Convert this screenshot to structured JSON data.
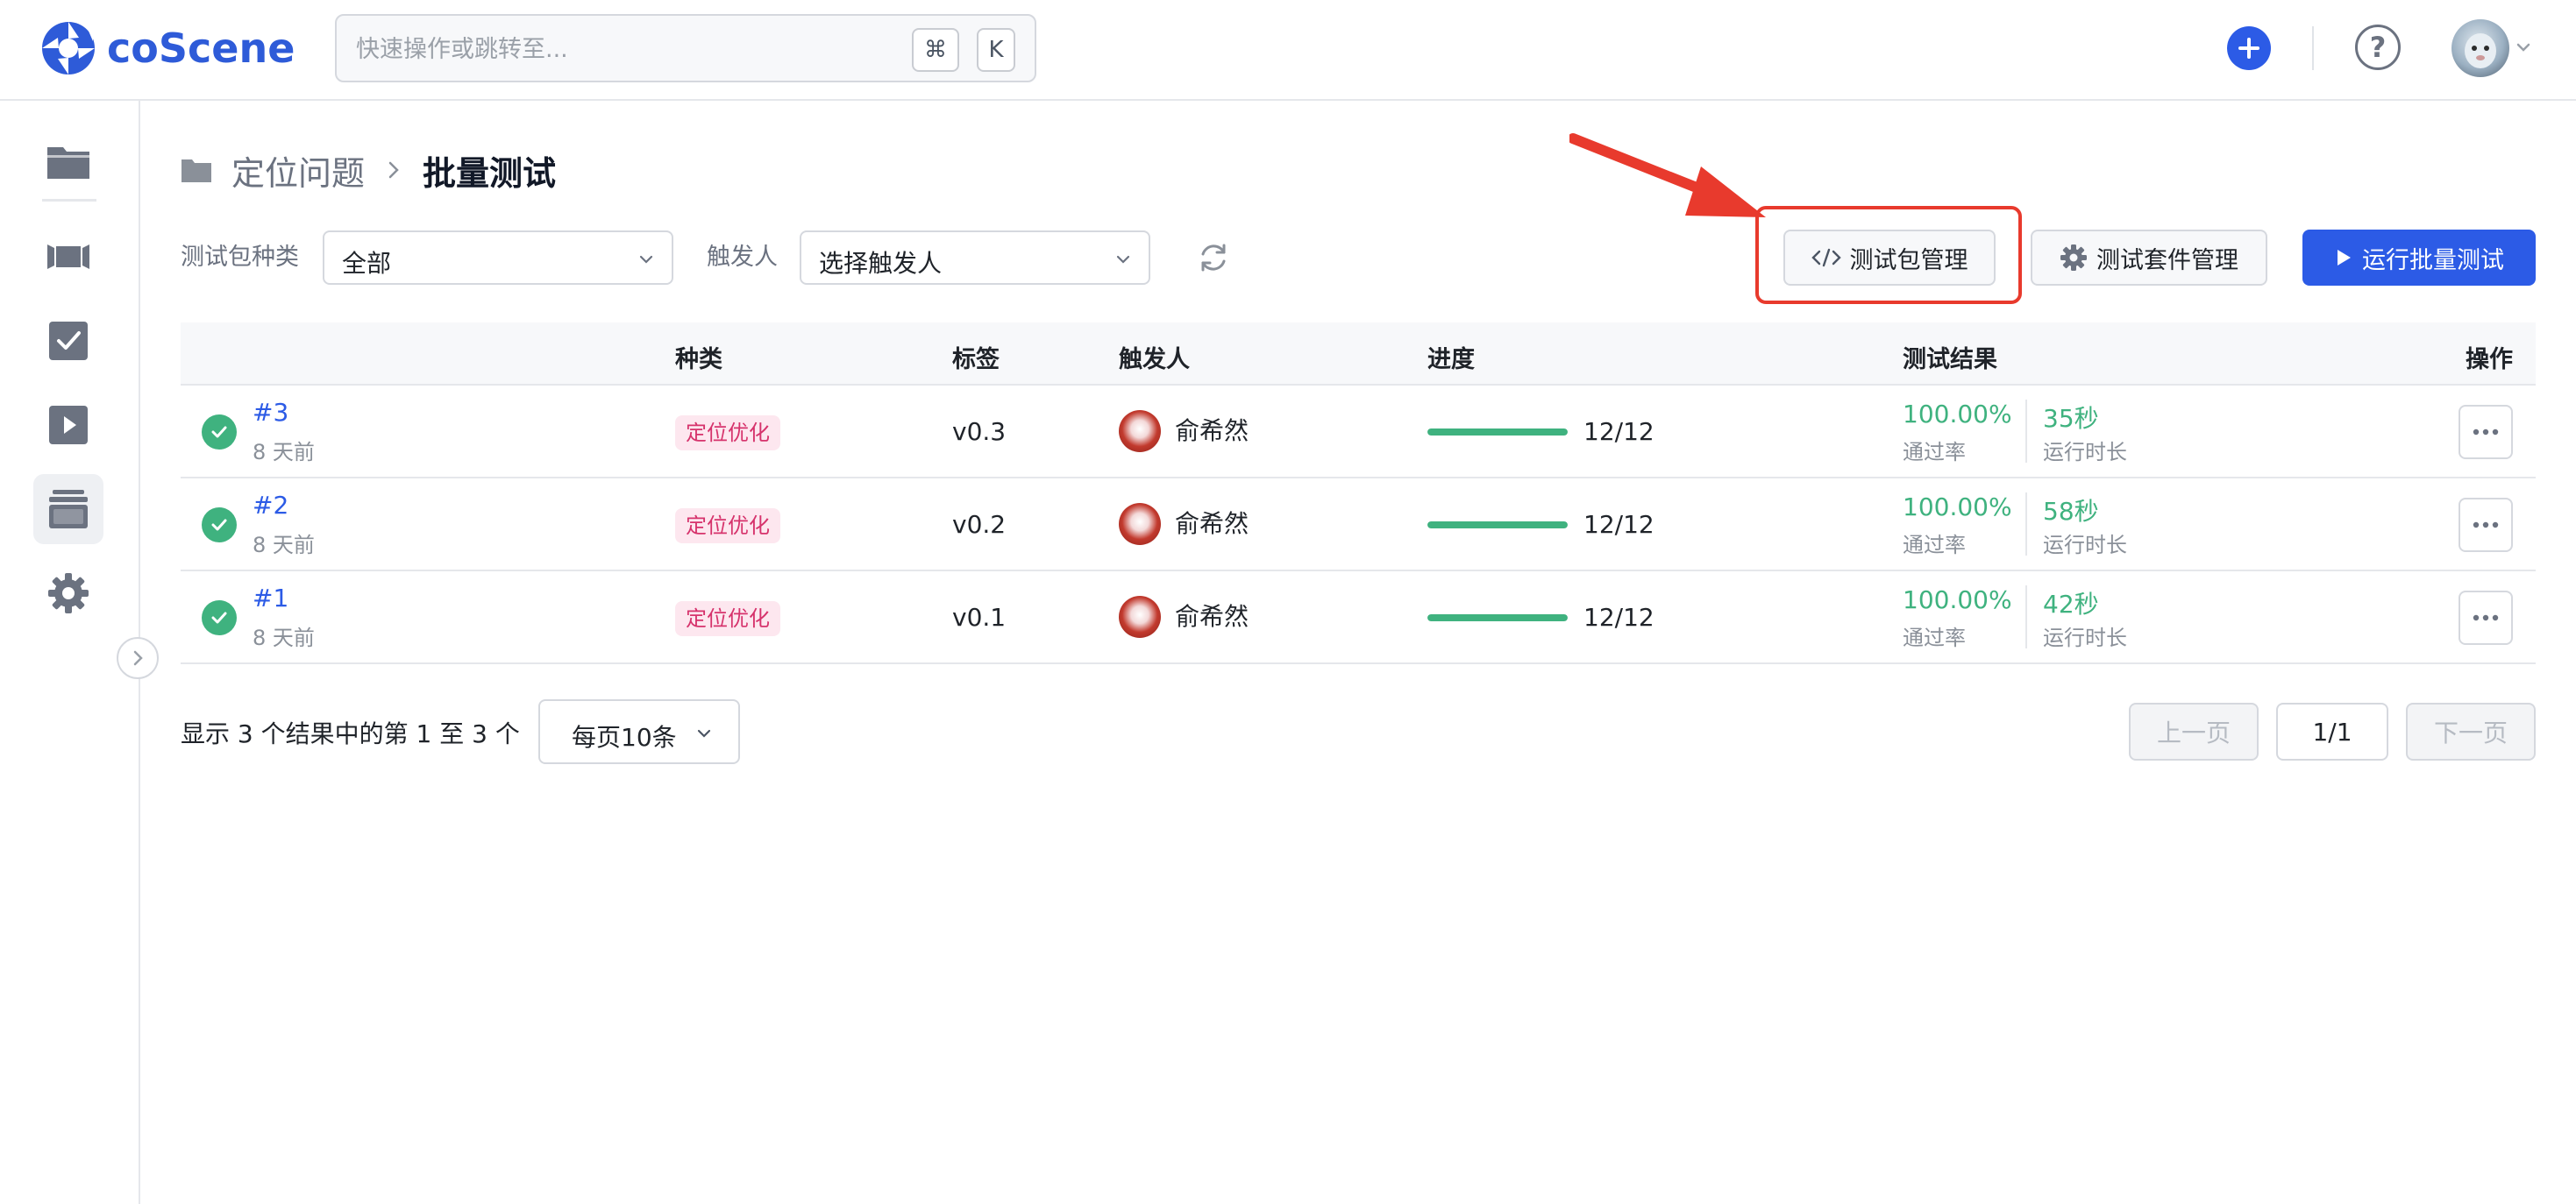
{
  "app": {
    "brand": "coScene",
    "brand_color": "#2e5bd8",
    "accent_color": "#2c5be6"
  },
  "search": {
    "placeholder": "快速操作或跳转至...",
    "shortcut_cmd": "⌘",
    "shortcut_key": "K"
  },
  "header": {
    "add_icon": "plus-circle-icon",
    "help_icon": "question-circle-icon",
    "help_glyph": "?"
  },
  "sidebar": {
    "items": [
      {
        "name": "records",
        "icon": "folder-icon"
      },
      {
        "name": "scenes",
        "icon": "film-icon"
      },
      {
        "name": "tasks",
        "icon": "checkbox-icon"
      },
      {
        "name": "playback",
        "icon": "play-icon"
      },
      {
        "name": "batch-test",
        "icon": "archive-icon",
        "active": true
      },
      {
        "name": "settings",
        "icon": "gear-icon"
      }
    ]
  },
  "breadcrumb": {
    "parent": "定位问题",
    "current": "批量测试"
  },
  "filters": {
    "package_type_label": "测试包种类",
    "package_type_value": "全部",
    "trigger_label": "触发人",
    "trigger_placeholder": "选择触发人"
  },
  "actions": {
    "package_manage": "测试包管理",
    "suite_manage": "测试套件管理",
    "run_batch": "运行批量测试"
  },
  "table": {
    "headers": {
      "kind": "种类",
      "tag": "标签",
      "trigger": "触发人",
      "progress": "进度",
      "result": "测试结果",
      "actions": "操作"
    },
    "rows": [
      {
        "id": "#3",
        "time": "8 天前",
        "kind": "定位优化",
        "tag": "v0.3",
        "user": "俞希然",
        "progress_text": "12/12",
        "progress_pct": 100,
        "pass_rate": "100.00%",
        "pass_rate_label": "通过率",
        "duration": "35秒",
        "duration_label": "运行时长"
      },
      {
        "id": "#2",
        "time": "8 天前",
        "kind": "定位优化",
        "tag": "v0.2",
        "user": "俞希然",
        "progress_text": "12/12",
        "progress_pct": 100,
        "pass_rate": "100.00%",
        "pass_rate_label": "通过率",
        "duration": "58秒",
        "duration_label": "运行时长"
      },
      {
        "id": "#1",
        "time": "8 天前",
        "kind": "定位优化",
        "tag": "v0.1",
        "user": "俞希然",
        "progress_text": "12/12",
        "progress_pct": 100,
        "pass_rate": "100.00%",
        "pass_rate_label": "通过率",
        "duration": "42秒",
        "duration_label": "运行时长"
      }
    ]
  },
  "pagination": {
    "summary": "显示 3 个结果中的第 1 至 3 个",
    "per_page": "每页10条",
    "prev": "上一页",
    "page": "1/1",
    "next": "下一页"
  },
  "colors": {
    "success": "#3fb27f",
    "tag_bg": "#fde7ef",
    "tag_text": "#d6336c",
    "annotation": "#e83a2d"
  }
}
